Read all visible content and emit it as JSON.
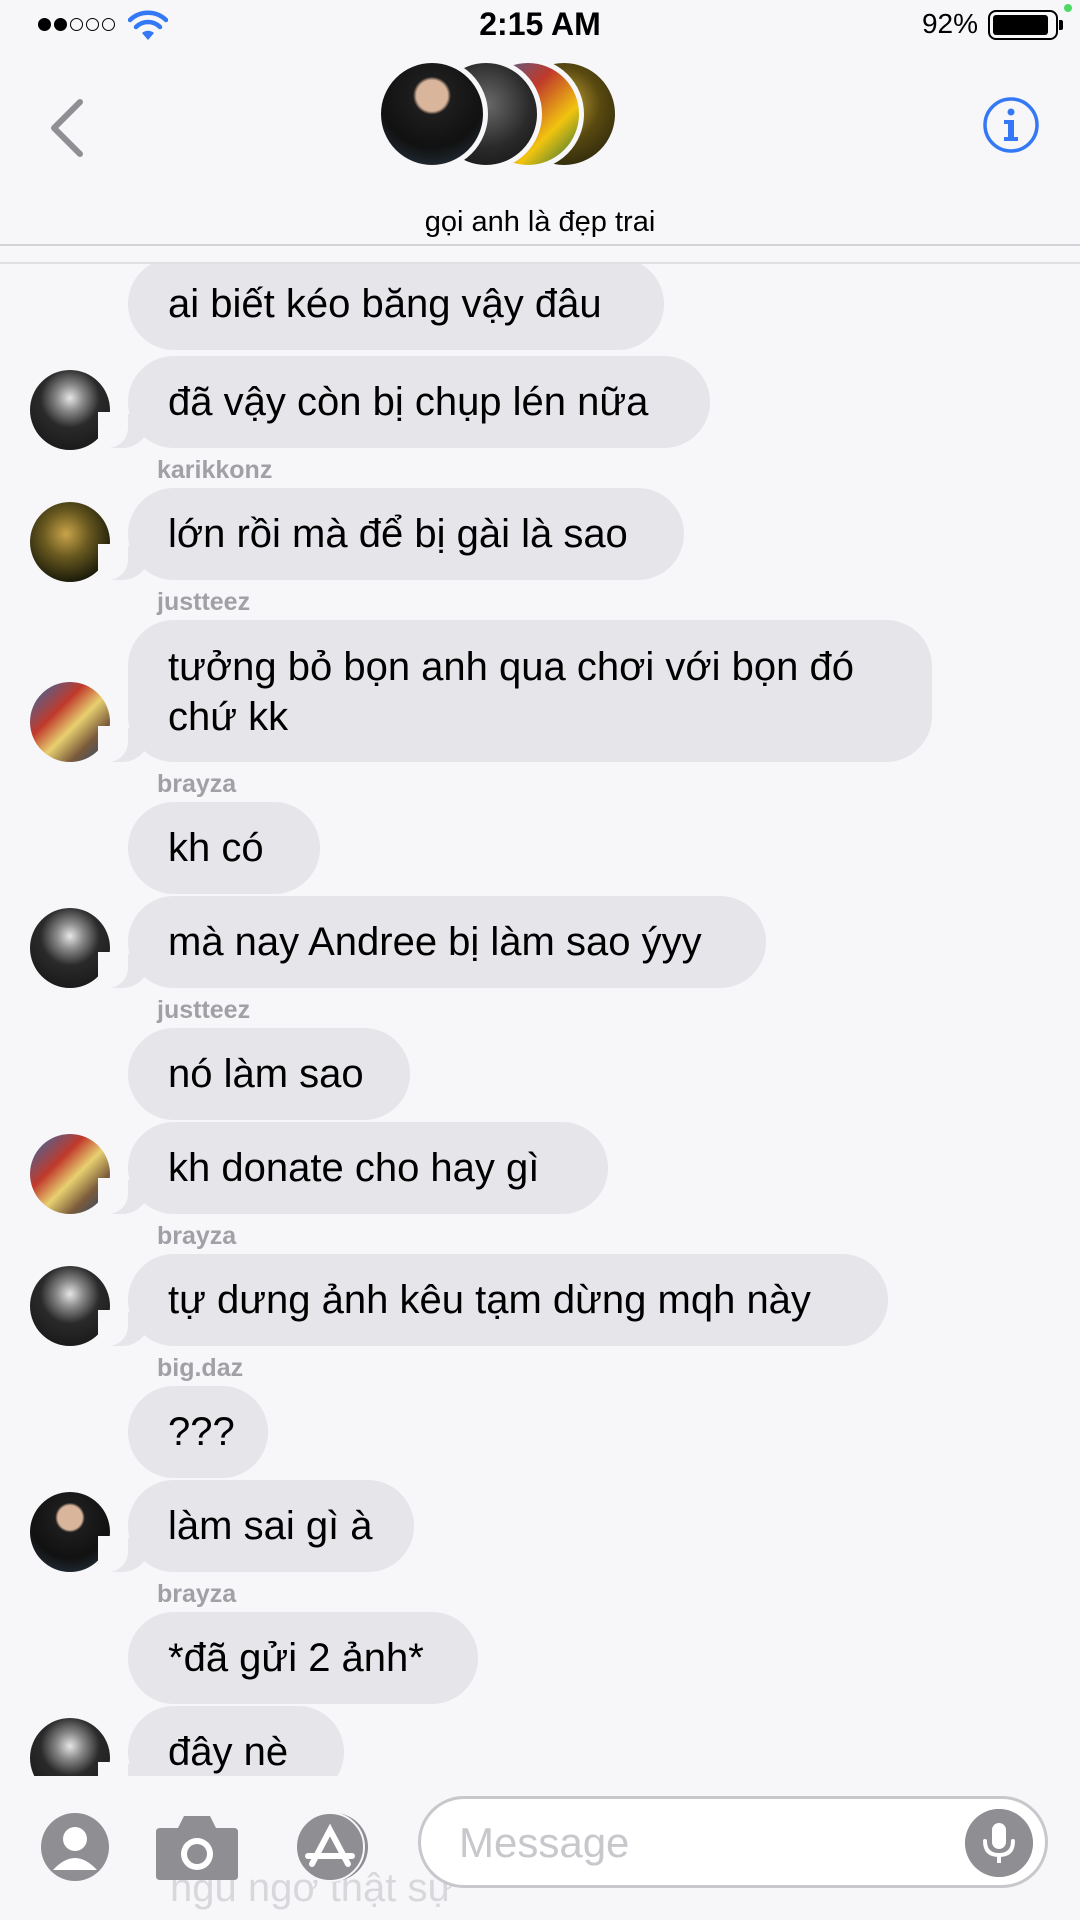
{
  "status_bar": {
    "time": "2:15 AM",
    "battery": "92%",
    "battery_level": 0.92
  },
  "header": {
    "group_name": "gọi anh là đẹp trai",
    "avatar_icons": [
      "group-avatar-1",
      "group-avatar-2",
      "group-avatar-3",
      "group-avatar-4"
    ]
  },
  "messages": [
    {
      "text": "ai biết kéo băng vậy đâu"
    },
    {
      "text": "đã vậy còn bị chụp lén nữa"
    },
    {
      "sender": "karikkonz",
      "text": "lớn rồi mà để bị gài là sao"
    },
    {
      "sender": "justteez",
      "text_line1": "tưởng bỏ bọn anh qua chơi với bọn đó",
      "text_line2": "chứ kk"
    },
    {
      "sender": "brayza",
      "text": "kh có"
    },
    {
      "text": "mà nay Andree bị làm sao ýyy"
    },
    {
      "sender": "justteez",
      "text": "nó làm sao"
    },
    {
      "text": "kh donate cho hay gì"
    },
    {
      "sender": "brayza",
      "text": "tự dưng ảnh kêu tạm dừng mqh này"
    },
    {
      "sender": "big.daz",
      "text": "???"
    },
    {
      "text": "làm sai gì à"
    },
    {
      "sender": "brayza",
      "text": "*đã gửi 2 ảnh*"
    },
    {
      "text": "đây nè"
    }
  ],
  "input_bar": {
    "placeholder": "Message",
    "faded_text": "ngu ngơ thật sự"
  },
  "colors": {
    "bubble": "#e5e5ea",
    "background": "#f7f7f9",
    "accent": "#3478f6",
    "sender": "#a0a0a6"
  }
}
